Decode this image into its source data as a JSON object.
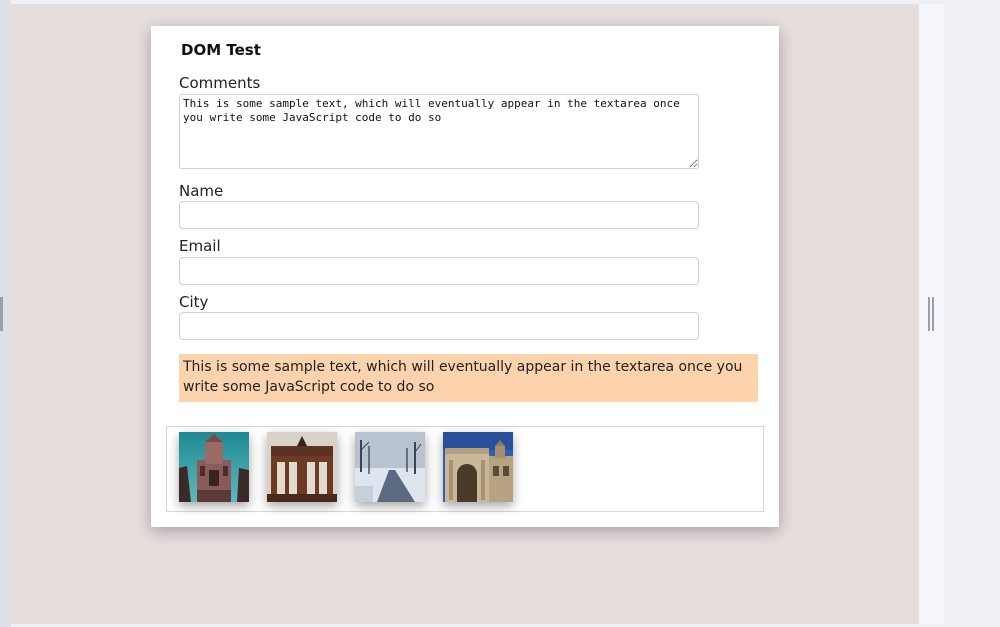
{
  "form": {
    "title": "DOM Test",
    "comments_label": "Comments",
    "comments_value": "This is some sample text, which will eventually appear in the textarea once you write some JavaScript code to do so",
    "name_label": "Name",
    "name_value": "",
    "email_label": "Email",
    "email_value": "",
    "city_label": "City",
    "city_value": ""
  },
  "output": {
    "text": "This is some sample text, which will eventually appear in the textarea once you write some JavaScript code to do so"
  },
  "gallery": {
    "images": [
      {
        "subject": "church-tower"
      },
      {
        "subject": "city-gate"
      },
      {
        "subject": "snowy-path"
      },
      {
        "subject": "triumphal-arch"
      }
    ]
  },
  "colors": {
    "output_background": "#fdd3ae",
    "stage_background": "#e6dddd"
  }
}
